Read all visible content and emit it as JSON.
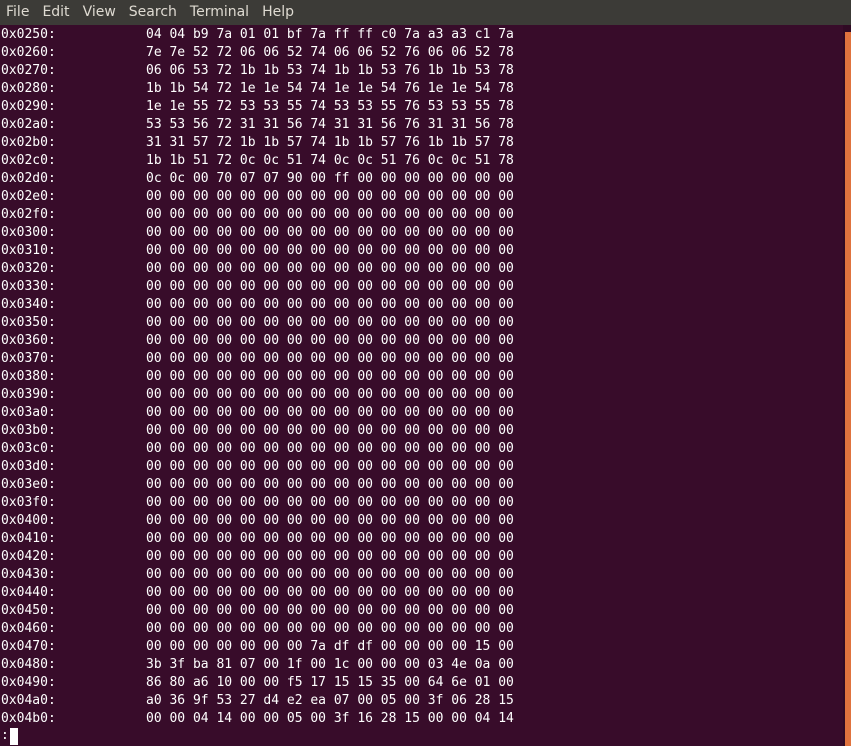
{
  "menu": [
    "File",
    "Edit",
    "View",
    "Search",
    "Terminal",
    "Help"
  ],
  "colors": {
    "menubar": "#3c3b37",
    "terminal_bg": "#380c2a",
    "text": "#ffffff",
    "scroll_indicator": "#e0733e"
  },
  "lines": [
    {
      "addr": "0x0250:",
      "bytes": "04 04 b9 7a 01 01 bf 7a ff ff c0 7a a3 a3 c1 7a"
    },
    {
      "addr": "0x0260:",
      "bytes": "7e 7e 52 72 06 06 52 74 06 06 52 76 06 06 52 78"
    },
    {
      "addr": "0x0270:",
      "bytes": "06 06 53 72 1b 1b 53 74 1b 1b 53 76 1b 1b 53 78"
    },
    {
      "addr": "0x0280:",
      "bytes": "1b 1b 54 72 1e 1e 54 74 1e 1e 54 76 1e 1e 54 78"
    },
    {
      "addr": "0x0290:",
      "bytes": "1e 1e 55 72 53 53 55 74 53 53 55 76 53 53 55 78"
    },
    {
      "addr": "0x02a0:",
      "bytes": "53 53 56 72 31 31 56 74 31 31 56 76 31 31 56 78"
    },
    {
      "addr": "0x02b0:",
      "bytes": "31 31 57 72 1b 1b 57 74 1b 1b 57 76 1b 1b 57 78"
    },
    {
      "addr": "0x02c0:",
      "bytes": "1b 1b 51 72 0c 0c 51 74 0c 0c 51 76 0c 0c 51 78"
    },
    {
      "addr": "0x02d0:",
      "bytes": "0c 0c 00 70 07 07 90 00 ff 00 00 00 00 00 00 00"
    },
    {
      "addr": "0x02e0:",
      "bytes": "00 00 00 00 00 00 00 00 00 00 00 00 00 00 00 00"
    },
    {
      "addr": "0x02f0:",
      "bytes": "00 00 00 00 00 00 00 00 00 00 00 00 00 00 00 00"
    },
    {
      "addr": "0x0300:",
      "bytes": "00 00 00 00 00 00 00 00 00 00 00 00 00 00 00 00"
    },
    {
      "addr": "0x0310:",
      "bytes": "00 00 00 00 00 00 00 00 00 00 00 00 00 00 00 00"
    },
    {
      "addr": "0x0320:",
      "bytes": "00 00 00 00 00 00 00 00 00 00 00 00 00 00 00 00"
    },
    {
      "addr": "0x0330:",
      "bytes": "00 00 00 00 00 00 00 00 00 00 00 00 00 00 00 00"
    },
    {
      "addr": "0x0340:",
      "bytes": "00 00 00 00 00 00 00 00 00 00 00 00 00 00 00 00"
    },
    {
      "addr": "0x0350:",
      "bytes": "00 00 00 00 00 00 00 00 00 00 00 00 00 00 00 00"
    },
    {
      "addr": "0x0360:",
      "bytes": "00 00 00 00 00 00 00 00 00 00 00 00 00 00 00 00"
    },
    {
      "addr": "0x0370:",
      "bytes": "00 00 00 00 00 00 00 00 00 00 00 00 00 00 00 00"
    },
    {
      "addr": "0x0380:",
      "bytes": "00 00 00 00 00 00 00 00 00 00 00 00 00 00 00 00"
    },
    {
      "addr": "0x0390:",
      "bytes": "00 00 00 00 00 00 00 00 00 00 00 00 00 00 00 00"
    },
    {
      "addr": "0x03a0:",
      "bytes": "00 00 00 00 00 00 00 00 00 00 00 00 00 00 00 00"
    },
    {
      "addr": "0x03b0:",
      "bytes": "00 00 00 00 00 00 00 00 00 00 00 00 00 00 00 00"
    },
    {
      "addr": "0x03c0:",
      "bytes": "00 00 00 00 00 00 00 00 00 00 00 00 00 00 00 00"
    },
    {
      "addr": "0x03d0:",
      "bytes": "00 00 00 00 00 00 00 00 00 00 00 00 00 00 00 00"
    },
    {
      "addr": "0x03e0:",
      "bytes": "00 00 00 00 00 00 00 00 00 00 00 00 00 00 00 00"
    },
    {
      "addr": "0x03f0:",
      "bytes": "00 00 00 00 00 00 00 00 00 00 00 00 00 00 00 00"
    },
    {
      "addr": "0x0400:",
      "bytes": "00 00 00 00 00 00 00 00 00 00 00 00 00 00 00 00"
    },
    {
      "addr": "0x0410:",
      "bytes": "00 00 00 00 00 00 00 00 00 00 00 00 00 00 00 00"
    },
    {
      "addr": "0x0420:",
      "bytes": "00 00 00 00 00 00 00 00 00 00 00 00 00 00 00 00"
    },
    {
      "addr": "0x0430:",
      "bytes": "00 00 00 00 00 00 00 00 00 00 00 00 00 00 00 00"
    },
    {
      "addr": "0x0440:",
      "bytes": "00 00 00 00 00 00 00 00 00 00 00 00 00 00 00 00"
    },
    {
      "addr": "0x0450:",
      "bytes": "00 00 00 00 00 00 00 00 00 00 00 00 00 00 00 00"
    },
    {
      "addr": "0x0460:",
      "bytes": "00 00 00 00 00 00 00 00 00 00 00 00 00 00 00 00"
    },
    {
      "addr": "0x0470:",
      "bytes": "00 00 00 00 00 00 00 7a df df 00 00 00 00 15 00"
    },
    {
      "addr": "0x0480:",
      "bytes": "3b 3f ba 81 07 00 1f 00 1c 00 00 00 03 4e 0a 00"
    },
    {
      "addr": "0x0490:",
      "bytes": "86 80 a6 10 00 00 f5 17 15 15 35 00 64 6e 01 00"
    },
    {
      "addr": "0x04a0:",
      "bytes": "a0 36 9f 53 27 d4 e2 ea 07 00 05 00 3f 06 28 15"
    },
    {
      "addr": "0x04b0:",
      "bytes": "00 00 04 14 00 00 05 00 3f 16 28 15 00 00 04 14"
    }
  ],
  "prompt": ":"
}
